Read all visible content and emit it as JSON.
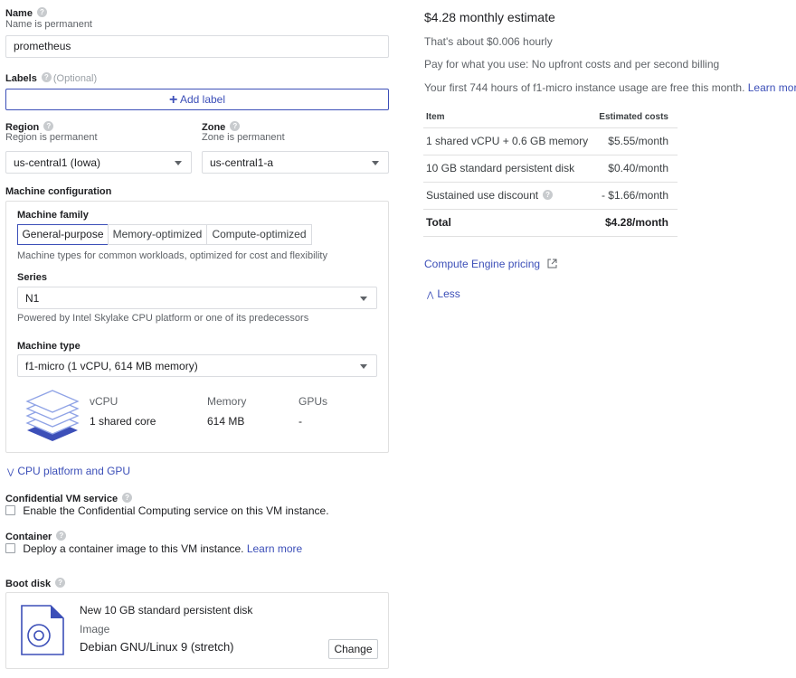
{
  "name": {
    "label": "Name",
    "hint": "Name is permanent",
    "value": "prometheus"
  },
  "labels": {
    "label": "Labels",
    "optional": "(Optional)",
    "add_button": "Add label"
  },
  "region": {
    "label": "Region",
    "hint": "Region is permanent",
    "value": "us-central1 (Iowa)"
  },
  "zone": {
    "label": "Zone",
    "hint": "Zone is permanent",
    "value": "us-central1-a"
  },
  "machine_config": {
    "title": "Machine configuration",
    "family_label": "Machine family",
    "tabs": [
      "General-purpose",
      "Memory-optimized",
      "Compute-optimized"
    ],
    "active_tab": "General-purpose",
    "family_desc": "Machine types for common workloads, optimized for cost and flexibility",
    "series_label": "Series",
    "series_value": "N1",
    "series_desc": "Powered by Intel Skylake CPU platform or one of its predecessors",
    "type_label": "Machine type",
    "type_value": "f1-micro (1 vCPU, 614 MB memory)",
    "specs": {
      "vcpu_label": "vCPU",
      "vcpu_value": "1 shared core",
      "memory_label": "Memory",
      "memory_value": "614 MB",
      "gpus_label": "GPUs",
      "gpus_value": "-"
    }
  },
  "cpu_platform_link": "CPU platform and GPU",
  "confidential": {
    "label": "Confidential VM service",
    "checkbox_text": "Enable the Confidential Computing service on this VM instance."
  },
  "container": {
    "label": "Container",
    "checkbox_text": "Deploy a container image to this VM instance.",
    "learn_more": "Learn more"
  },
  "boot_disk": {
    "label": "Boot disk",
    "title": "New 10 GB standard persistent disk",
    "image_label": "Image",
    "image_value": "Debian GNU/Linux 9 (stretch)",
    "change_button": "Change"
  },
  "estimate": {
    "title": "$4.28 monthly estimate",
    "hourly": "That's about $0.006 hourly",
    "pay_note": "Pay for what you use: No upfront costs and per second billing",
    "free_note": "Your first 744 hours of f1-micro instance usage are free this month.",
    "learn_more": "Learn more",
    "table": {
      "headers": [
        "Item",
        "Estimated costs"
      ],
      "rows": [
        [
          "1 shared vCPU + 0.6 GB memory",
          "$5.55/month"
        ],
        [
          "10 GB standard persistent disk",
          "$0.40/month"
        ],
        [
          "Sustained use discount",
          "- $1.66/month"
        ]
      ],
      "total": [
        "Total",
        "$4.28/month"
      ]
    },
    "pricing_link": "Compute Engine pricing",
    "less_link": "Less"
  },
  "colors": {
    "accent": "#3c4fb8",
    "border": "#dadce0",
    "muted": "#5f6368"
  }
}
